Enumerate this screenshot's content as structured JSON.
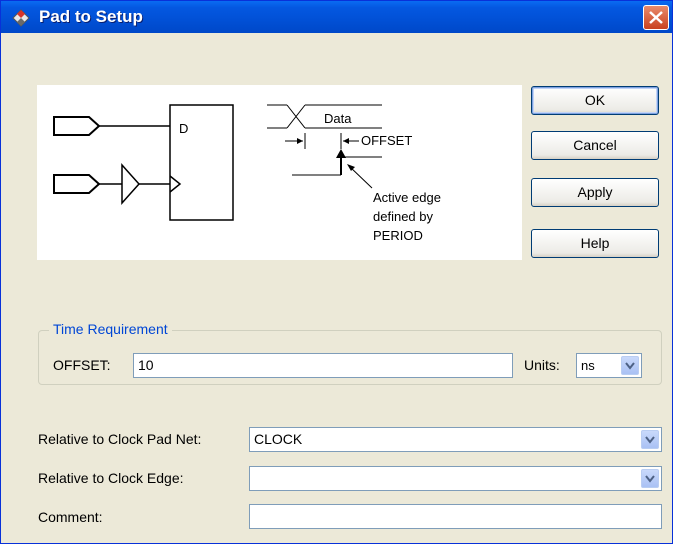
{
  "window": {
    "title": "Pad to Setup"
  },
  "diagram": {
    "d_label": "D",
    "data_label": "Data",
    "offset_label": "OFFSET",
    "active_edge_lines": [
      "Active edge",
      "defined by",
      "PERIOD"
    ]
  },
  "buttons": {
    "ok": "OK",
    "cancel": "Cancel",
    "apply": "Apply",
    "help": "Help"
  },
  "time_requirement": {
    "legend": "Time Requirement",
    "offset_label": "OFFSET:",
    "offset_value": "10",
    "units_label": "Units:",
    "units_value": "ns"
  },
  "fields": {
    "clock_pad_net_label": "Relative to Clock Pad Net:",
    "clock_pad_net_value": "CLOCK",
    "clock_edge_label": "Relative to Clock Edge:",
    "clock_edge_value": "",
    "comment_label": "Comment:",
    "comment_value": ""
  },
  "colors": {
    "titlebar": "#0054e3",
    "dialog_bg": "#ece9d8",
    "group_legend": "#0046d5",
    "close": "#d9512e"
  }
}
